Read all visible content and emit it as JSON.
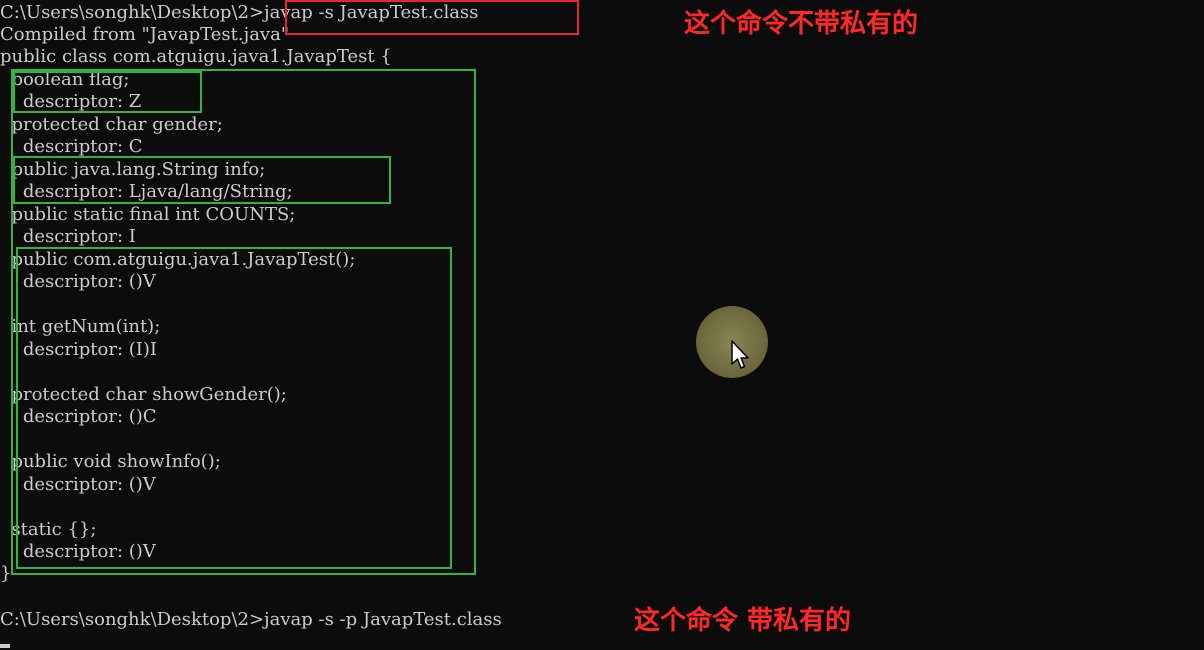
{
  "terminal": {
    "lines": [
      "C:\\Users\\songhk\\Desktop\\2>javap -s JavapTest.class",
      "Compiled from \"JavapTest.java\"",
      "public class com.atguigu.java1.JavapTest {",
      "  boolean flag;",
      "    descriptor: Z",
      "  protected char gender;",
      "    descriptor: C",
      "  public java.lang.String info;",
      "    descriptor: Ljava/lang/String;",
      "  public static final int COUNTS;",
      "    descriptor: I",
      "  public com.atguigu.java1.JavapTest();",
      "    descriptor: ()V",
      "",
      "  int getNum(int);",
      "    descriptor: (I)I",
      "",
      "  protected char showGender();",
      "    descriptor: ()C",
      "",
      "  public void showInfo();",
      "    descriptor: ()V",
      "",
      "  static {};",
      "    descriptor: ()V",
      "}",
      "",
      "C:\\Users\\songhk\\Desktop\\2>javap -s -p JavapTest.class"
    ]
  },
  "annotations": {
    "top_note": "这个命令不带私有的",
    "bottom_note": "这个命令 带私有的",
    "color": "#ff2828"
  },
  "highlight_colors": {
    "command_box": "#e0282e",
    "section_box": "#33b346"
  },
  "icons": {
    "mouse_pointer": "arrow-cursor-icon"
  }
}
